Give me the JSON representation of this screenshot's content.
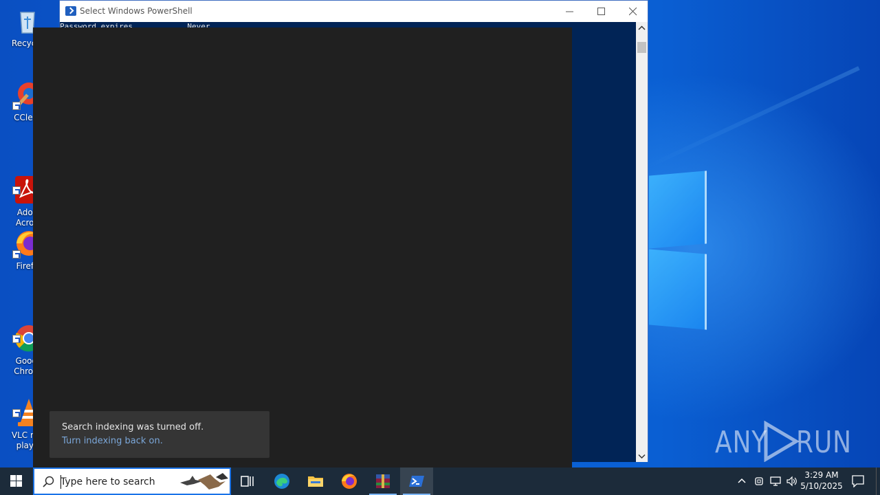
{
  "desktop": {
    "icons": [
      {
        "label": "Recycle",
        "icon": "recycle-bin-icon"
      },
      {
        "label": "CClear",
        "icon": "ccleaner-icon"
      },
      {
        "label": "Adob\nAcrob",
        "icon": "adobe-acrobat-icon"
      },
      {
        "label": "Firefo",
        "icon": "firefox-icon"
      },
      {
        "label": "Googl\nChrom",
        "icon": "chrome-icon"
      },
      {
        "label": "VLC me\nplaye",
        "icon": "vlc-icon"
      }
    ]
  },
  "powershell": {
    "title": "Select Windows PowerShell",
    "line": "Password expires            Never"
  },
  "toast": {
    "message": "Search indexing was turned off.",
    "link": "Turn indexing back on."
  },
  "watermark": {
    "left": "ANY",
    "right": "RUN"
  },
  "taskbar": {
    "search_placeholder": "Type here to search",
    "apps": [
      "task-view-icon",
      "edge-icon",
      "file-explorer-icon",
      "firefox-icon",
      "winrar-icon",
      "powershell-icon"
    ],
    "clock_time": "3:29 AM",
    "clock_date": "5/10/2025"
  },
  "colors": {
    "console_bg": "#012456",
    "panel_bg": "#202020",
    "toast_bg": "#353535",
    "taskbar_bg": "#1c2b3a",
    "link": "#7ba7d9"
  }
}
